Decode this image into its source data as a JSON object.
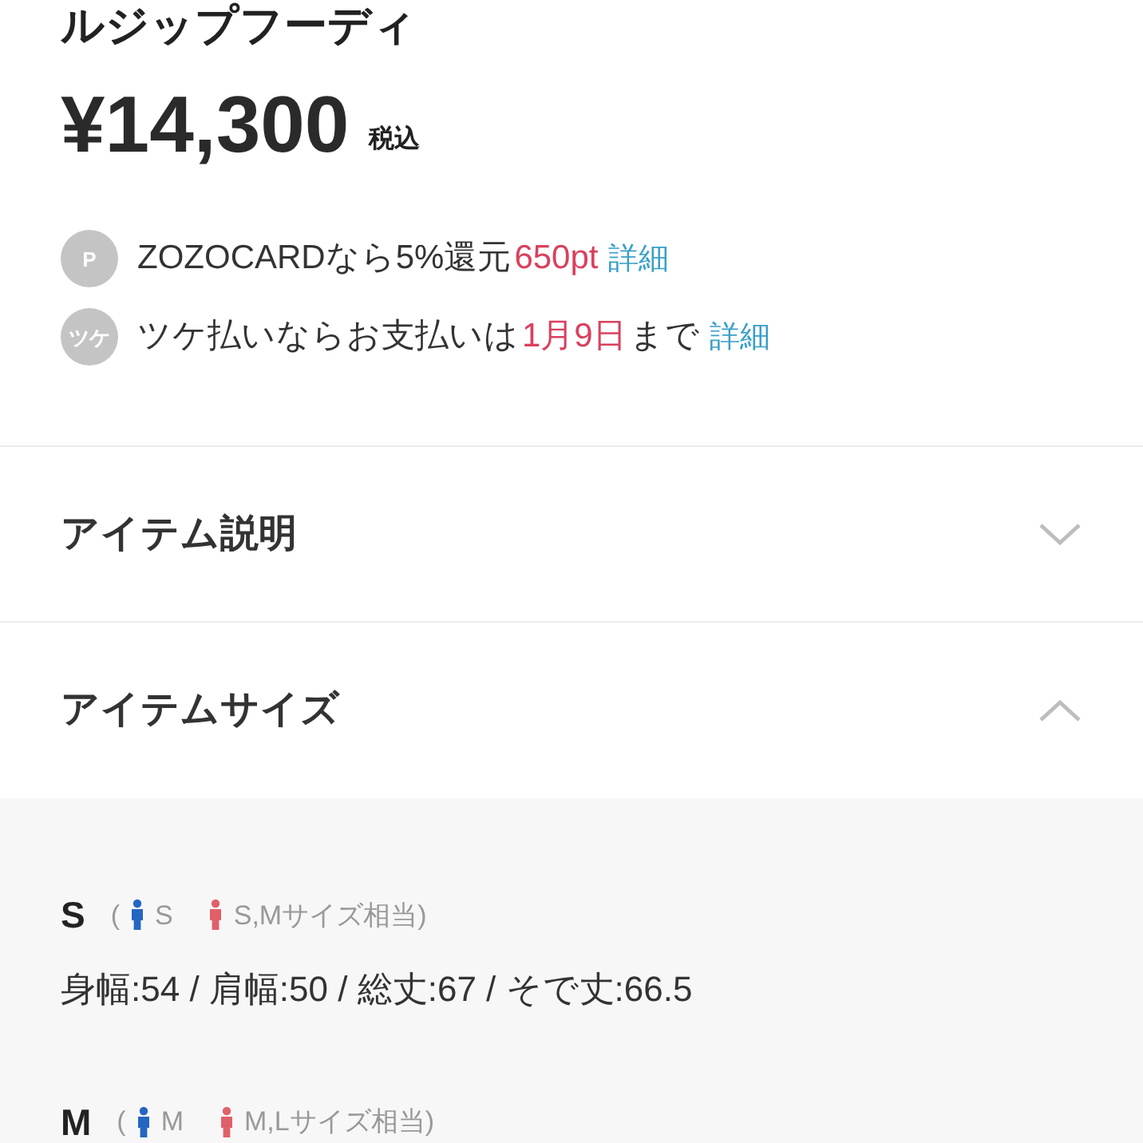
{
  "title": "ルジップフーディ",
  "price": {
    "amount": "¥14,300",
    "tax_note": "税込"
  },
  "offers": [
    {
      "badge": "P",
      "segments": [
        {
          "kind": "plain",
          "text": "ZOZOCARDなら5%還元"
        },
        {
          "kind": "highlight",
          "text": "650pt"
        },
        {
          "kind": "link",
          "text": "詳細"
        }
      ]
    },
    {
      "badge": "ツケ",
      "segments": [
        {
          "kind": "plain",
          "text": "ツケ払いならお支払いは"
        },
        {
          "kind": "highlight",
          "text": "1月9日"
        },
        {
          "kind": "plain",
          "text": "まで"
        },
        {
          "kind": "link",
          "text": "詳細"
        }
      ]
    }
  ],
  "sections": [
    {
      "title": "アイテム説明",
      "expanded": false
    },
    {
      "title": "アイテムサイズ",
      "expanded": true,
      "sizes": [
        {
          "size": "S",
          "open": "(",
          "men": "S",
          "women": "S,Mサイズ相当)",
          "measurements": "身幅:54 / 肩幅:50 / 総丈:67 / そで丈:66.5"
        },
        {
          "size": "M",
          "open": "(",
          "men": "M",
          "women": "M,Lサイズ相当)"
        }
      ]
    }
  ]
}
